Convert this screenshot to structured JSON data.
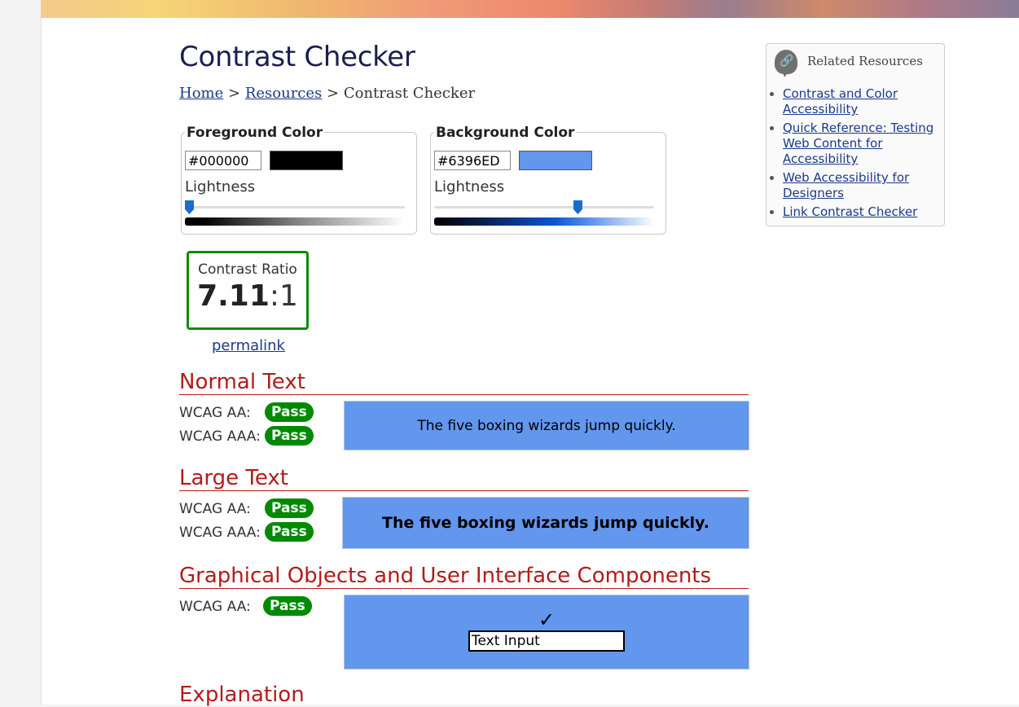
{
  "page": {
    "title": "Contrast Checker"
  },
  "breadcrumb": {
    "home": "Home",
    "sep1": ">",
    "resources": "Resources",
    "sep2": ">",
    "current": "Contrast Checker"
  },
  "foreground": {
    "legend": "Foreground Color",
    "hex": "#000000",
    "swatch": "#000000",
    "lightness_label": "Lightness",
    "lightness": 0.0
  },
  "background": {
    "legend": "Background Color",
    "hex": "#6396ED",
    "swatch": "#6396ED",
    "lightness_label": "Lightness",
    "lightness": 0.66
  },
  "contrast": {
    "label": "Contrast Ratio",
    "ratio": "7.11",
    "suffix": ":1",
    "permalink": "permalink"
  },
  "normal_text": {
    "heading": "Normal Text",
    "aa_label": "WCAG AA:",
    "aa_result": "Pass",
    "aaa_label": "WCAG AAA:",
    "aaa_result": "Pass",
    "sample": "The five boxing wizards jump quickly."
  },
  "large_text": {
    "heading": "Large Text",
    "aa_label": "WCAG AA:",
    "aa_result": "Pass",
    "aaa_label": "WCAG AAA:",
    "aaa_result": "Pass",
    "sample": "The five boxing wizards jump quickly."
  },
  "graphical": {
    "heading": "Graphical Objects and User Interface Components",
    "aa_label": "WCAG AA:",
    "aa_result": "Pass",
    "checkmark": "✓",
    "input_value": "Text Input"
  },
  "explanation": {
    "heading": "Explanation"
  },
  "sidebar": {
    "heading": "Related Resources",
    "icon": "link-icon",
    "items": [
      {
        "label": "Contrast and Color Accessibility"
      },
      {
        "label": "Quick Reference: Testing Web Content for Accessibility"
      },
      {
        "label": "Web Accessibility for Designers"
      },
      {
        "label": "Link Contrast Checker"
      }
    ]
  },
  "colors": {
    "pass": "#008a00",
    "heading": "#b31b1b",
    "demo_bg": "#6396ED",
    "link": "#1b3a8a"
  }
}
